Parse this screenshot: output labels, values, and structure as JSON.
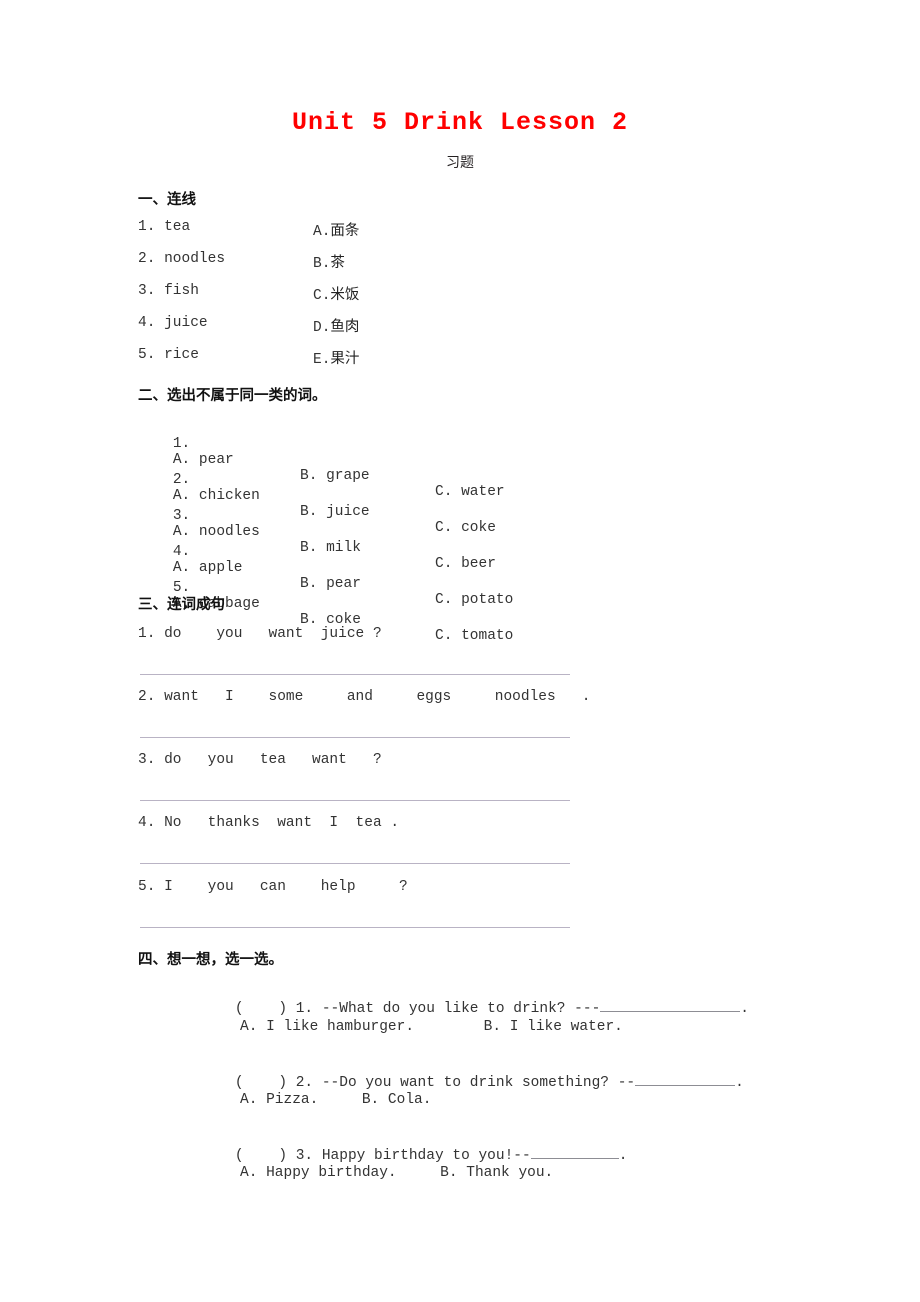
{
  "document": {
    "title": "Unit 5 Drink Lesson 2",
    "subtitle": "习题",
    "title_color": "#ff0000"
  },
  "section1": {
    "heading": "一、连线",
    "left_items": [
      "1. tea",
      "2. noodles",
      "3. fish",
      "4. juice",
      "5. rice"
    ],
    "right_labels": [
      "A.",
      "B.",
      "C.",
      "D.",
      "E."
    ],
    "right_items": [
      "面条",
      "茶",
      "米饭",
      "鱼肉",
      "果汁"
    ]
  },
  "section2": {
    "heading": "二、选出不属于同一类的词。",
    "items": [
      {
        "num": "1.",
        "a": "A. pear",
        "b": "B. grape",
        "c": "C. water"
      },
      {
        "num": "2.",
        "a": "A. chicken",
        "b": "B. juice",
        "c": "C. coke"
      },
      {
        "num": "3.",
        "a": "A. noodles",
        "b": "B. milk",
        "c": "C. beer"
      },
      {
        "num": "4.",
        "a": "A. apple",
        "b": "B. pear",
        "c": "C. potato"
      },
      {
        "num": "5.",
        "a": "A. cabbage",
        "b": "B. coke",
        "c": "C. tomato"
      }
    ]
  },
  "section3": {
    "heading": "三、连词成句",
    "items": [
      "1. do    you   want  juice ?",
      "2. want   I    some     and     eggs     noodles   .",
      "3. do   you   tea   want   ?",
      "4. No   thanks  want  I  tea .",
      "5. I    you   can    help     ?"
    ]
  },
  "section4": {
    "heading": "四、想一想，选一选。",
    "items": [
      {
        "bracket": "(    )",
        "num": "1.",
        "prompt": "--What do you like to drink? ---",
        "blank_width": 140,
        "tail": ".",
        "options": "A. I like hamburger.        B. I like water."
      },
      {
        "bracket": "(    )",
        "num": "2.",
        "prompt": "--Do you want to drink something? --",
        "blank_width": 100,
        "tail": ".",
        "options": "A. Pizza.     B. Cola."
      },
      {
        "bracket": "(    )",
        "num": "3.",
        "prompt": "Happy birthday to you!--",
        "blank_width": 88,
        "tail": ".",
        "options": "A. Happy birthday.     B. Thank you."
      }
    ]
  }
}
